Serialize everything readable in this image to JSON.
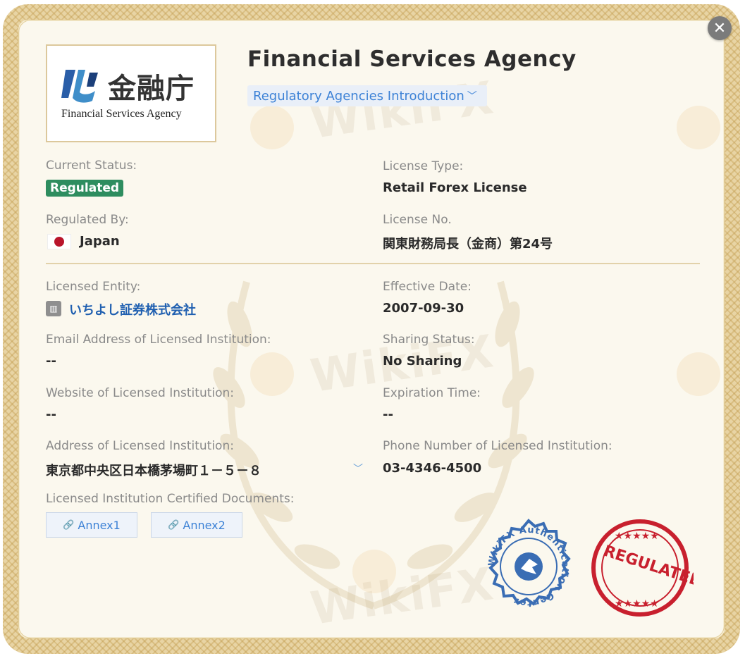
{
  "window": {
    "close_icon": "close-icon"
  },
  "logo": {
    "kanji": "金融庁",
    "english": "Financial Services Agency"
  },
  "header": {
    "title": "Financial Services Agency",
    "intro_link": "Regulatory Agencies Introduction",
    "intro_chevron": "chevron-down-icon"
  },
  "fields": {
    "current_status_label": "Current Status:",
    "current_status_value": "Regulated",
    "license_type_label": "License Type:",
    "license_type_value": "Retail Forex License",
    "regulated_by_label": "Regulated By:",
    "regulated_by_value": "Japan",
    "license_no_label": "License No.",
    "license_no_value": "関東財務局長（金商）第24号",
    "licensed_entity_label": "Licensed Entity:",
    "licensed_entity_value": "いちよし証券株式会社",
    "effective_date_label": "Effective Date:",
    "effective_date_value": "2007-09-30",
    "email_label": "Email Address of Licensed Institution:",
    "email_value": "--",
    "sharing_status_label": "Sharing Status:",
    "sharing_status_value": "No Sharing",
    "website_label": "Website of Licensed Institution:",
    "website_value": "--",
    "expiration_label": "Expiration Time:",
    "expiration_value": "--",
    "address_label": "Address of Licensed Institution:",
    "address_value": "東京都中央区日本橋茅場町１－５－８",
    "phone_label": "Phone Number of Licensed Institution:",
    "phone_value": "03-4346-4500",
    "documents_label": "Licensed Institution Certified Documents:"
  },
  "documents": [
    {
      "label": "Annex1"
    },
    {
      "label": "Annex2"
    }
  ],
  "seals": {
    "blue_text": "WikiFX Authentication Center",
    "red_text": "REGULATED"
  },
  "watermark": "WikiFX",
  "colors": {
    "regulated_badge": "#2e8d5f",
    "link_blue": "#3d82d6",
    "entity_link": "#1f5fb0",
    "seal_blue": "#3a6db4",
    "seal_red": "#c8202e",
    "frame_gold": "#e8d4a4"
  }
}
